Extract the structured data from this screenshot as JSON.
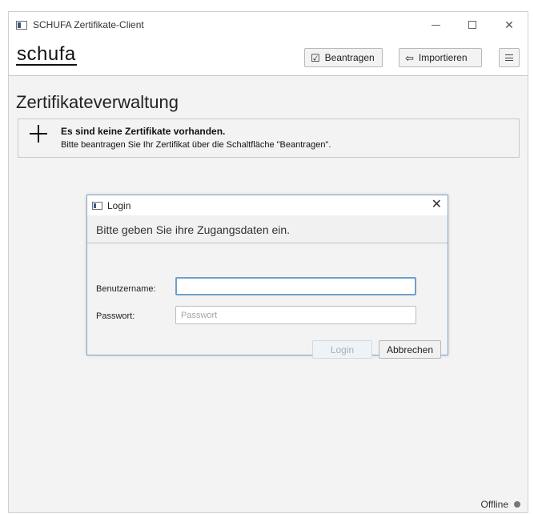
{
  "window": {
    "title": "SCHUFA Zertifikate-Client"
  },
  "toolbar": {
    "logo_text": "schufa",
    "beantragen_label": "Beantragen",
    "importieren_label": "Importieren",
    "menu_icon": "hamburger-icon"
  },
  "main": {
    "page_title": "Zertifikateverwaltung",
    "info": {
      "title": "Es sind keine Zertifikate vorhanden.",
      "text": "Bitte beantragen Sie Ihr Zertifikat über die Schaltfläche \"Beantragen\"."
    }
  },
  "dialog": {
    "title": "Login",
    "header": "Bitte geben Sie ihre Zugangsdaten ein.",
    "username_label": "Benutzername:",
    "username_value": "",
    "password_label": "Passwort:",
    "password_placeholder": "Passwort",
    "login_label": "Login",
    "cancel_label": "Abbrechen"
  },
  "status": {
    "text": "Offline"
  },
  "colors": {
    "focus_border": "#6e9fc8",
    "dialog_border": "#7fa3c7",
    "status_dot": "#777777"
  }
}
